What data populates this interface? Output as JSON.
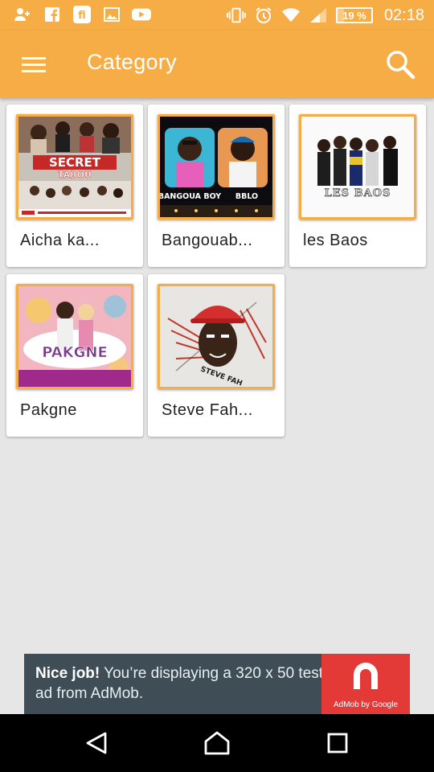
{
  "status_bar": {
    "left_icons": [
      "add-contact-icon",
      "facebook-icon",
      "fi-app-icon",
      "image-icon",
      "youtube-icon"
    ],
    "right_icons": [
      "vibrate-icon",
      "alarm-icon",
      "wifi-icon",
      "signal-icon"
    ],
    "battery_level": "19 %",
    "battery_fraction": 0.19,
    "time": "02:18"
  },
  "app_bar": {
    "title": "Category",
    "menu_icon": "hamburger-menu-icon",
    "search_icon": "search-icon",
    "color": "#f7ad45"
  },
  "categories": [
    {
      "label": "Aicha ka..."
    },
    {
      "label": "Bangouab..."
    },
    {
      "label": "les Baos"
    },
    {
      "label": "Pakgne"
    },
    {
      "label": "Steve Fah..."
    }
  ],
  "thumbnails": {
    "secret_title": "SECRET",
    "secret_subtitle": "TABOU",
    "bangoua_left": "BANGOUA BOY",
    "bangoua_right": "BBLO",
    "baos_title": "LES BAOS",
    "pakgne_title": "PAKGNE",
    "steve_tag": "STEVE FAH"
  },
  "ad": {
    "headline": "Nice job!",
    "body": " You’re displaying a 320 x 50 test ad from AdMob.",
    "brand": "AdMob by Google",
    "background": "#3e4d56",
    "logo_color": "#e33a38"
  },
  "nav_bar": {
    "back_icon": "back-triangle-icon",
    "home_icon": "home-icon",
    "recents_icon": "recents-square-icon"
  }
}
